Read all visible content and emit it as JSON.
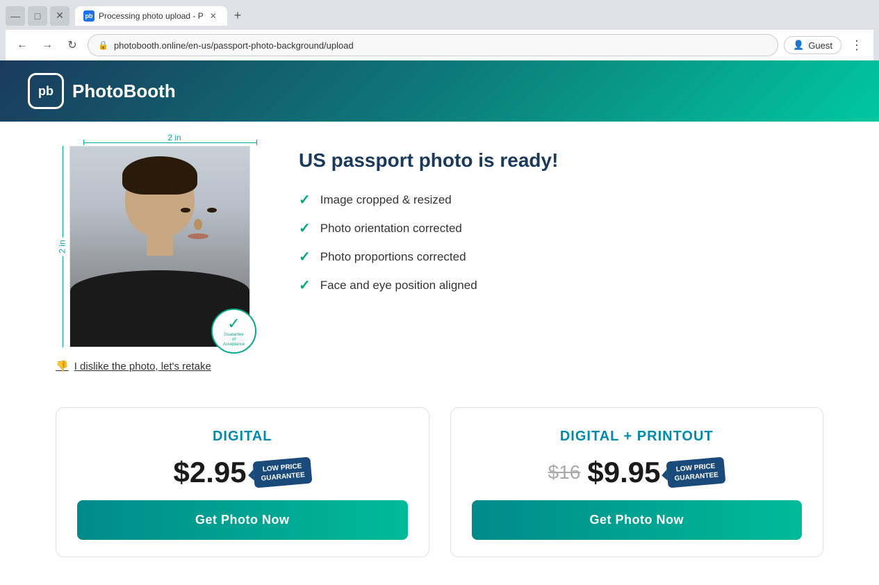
{
  "browser": {
    "tab_title": "Processing photo upload - P",
    "url": "photobooth.online/en-us/passport-photo-background/upload",
    "profile_label": "Guest"
  },
  "header": {
    "logo_text": "pb",
    "brand_name": "PhotoBooth"
  },
  "photo_section": {
    "width_label": "2 in",
    "height_label": "2 in",
    "guarantee_line1": "Guarantee",
    "guarantee_line2": "of",
    "guarantee_line3": "Acceptance",
    "retake_label": "I dislike the photo, let's retake"
  },
  "info_section": {
    "title": "US passport photo is ready!",
    "features": [
      "Image cropped & resized",
      "Photo orientation corrected",
      "Photo proportions corrected",
      "Face and eye position aligned"
    ]
  },
  "pricing": {
    "cards": [
      {
        "title": "DIGITAL",
        "price": "$2.95",
        "old_price": null,
        "badge_line1": "LOW PRICE",
        "badge_line2": "GUARANTEE",
        "button_label": "Get Photo Now"
      },
      {
        "title": "DIGITAL + PRINTOUT",
        "price": "$9.95",
        "old_price": "$16",
        "badge_line1": "LOW PRICE",
        "badge_line2": "GUARANTEE",
        "button_label": "Get Photo Now"
      }
    ]
  }
}
